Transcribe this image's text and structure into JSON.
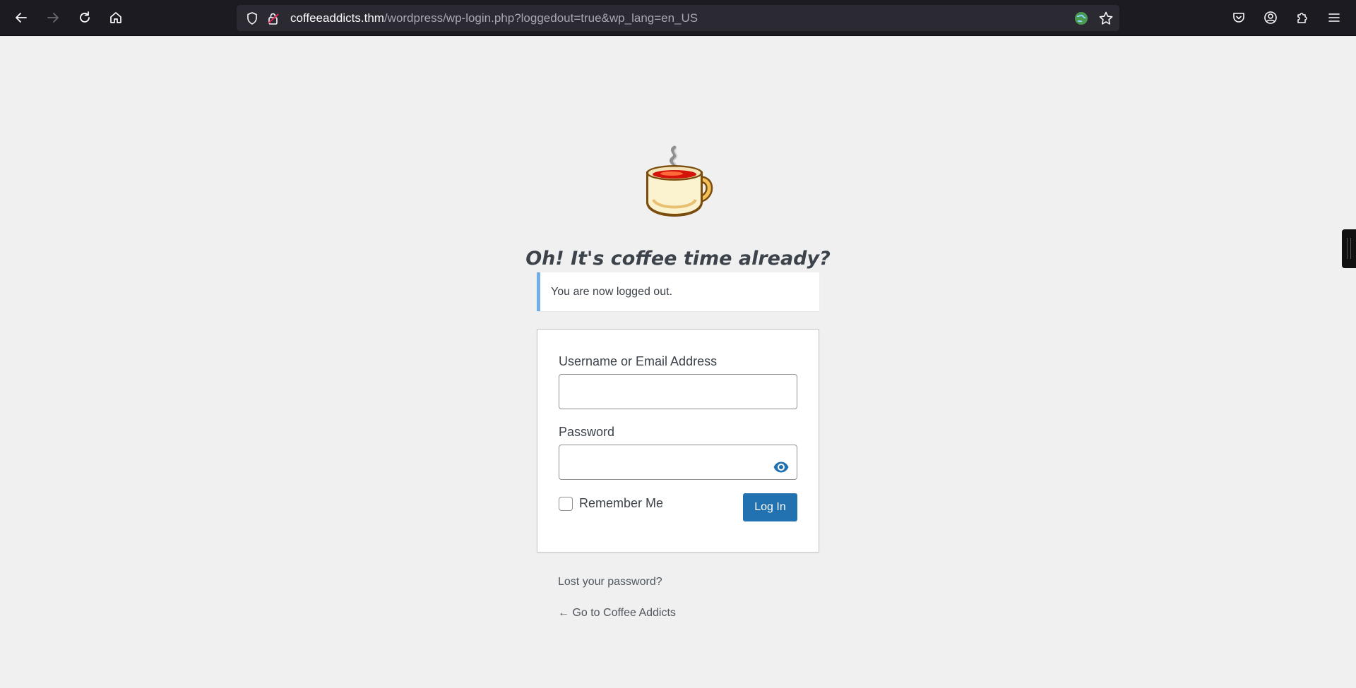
{
  "browser": {
    "url_host": "coffeeaddicts.thm",
    "url_path": "/wordpress/wp-login.php?loggedout=true&wp_lang=en_US",
    "icons": {
      "back": "back-arrow-icon",
      "forward": "forward-arrow-icon",
      "reload": "reload-icon",
      "home": "home-icon",
      "tracking_protection": "shield-icon",
      "connection": "insecure-lock-icon",
      "extension": "globe-extension-icon",
      "bookmark": "star-icon",
      "pocket": "pocket-icon",
      "account": "account-icon",
      "extensions": "puzzle-icon",
      "menu": "hamburger-menu-icon"
    }
  },
  "page": {
    "site_title": "Oh! It's coffee time already?",
    "notice": "You are now logged out.",
    "form": {
      "username_label": "Username or Email Address",
      "username_value": "",
      "password_label": "Password",
      "password_value": "",
      "remember_label": "Remember Me",
      "remember_checked": false,
      "submit_label": "Log In"
    },
    "lost_password_link": "Lost your password?",
    "back_link": "← Go to Coffee Addicts"
  },
  "colors": {
    "accent": "#2271b1",
    "notice_border": "#72aee6",
    "background": "#f0f0f1",
    "toolbar": "#1c1b22"
  }
}
